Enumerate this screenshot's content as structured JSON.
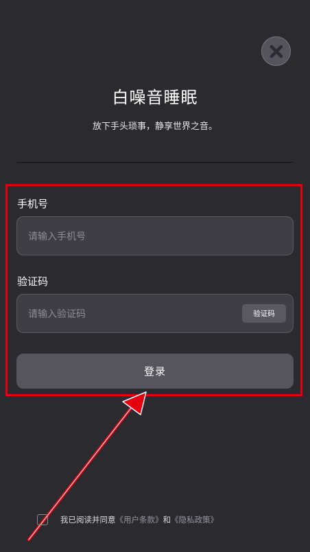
{
  "header": {
    "title": "白噪音睡眠",
    "subtitle": "放下手头琐事，静享世界之音。",
    "close_icon": "close-icon"
  },
  "form": {
    "phone": {
      "label": "手机号",
      "placeholder": "请输入手机号"
    },
    "code": {
      "label": "验证码",
      "placeholder": "请输入验证码",
      "button_label": "验证码"
    },
    "login_label": "登录"
  },
  "agreement": {
    "prefix": "我已阅读并同意",
    "terms_link": "《用户条款》",
    "and_text": "和",
    "privacy_link": "《隐私政策》"
  },
  "annotations": {
    "highlight_color": "#e3000f",
    "arrow_color": "#e3000f"
  }
}
